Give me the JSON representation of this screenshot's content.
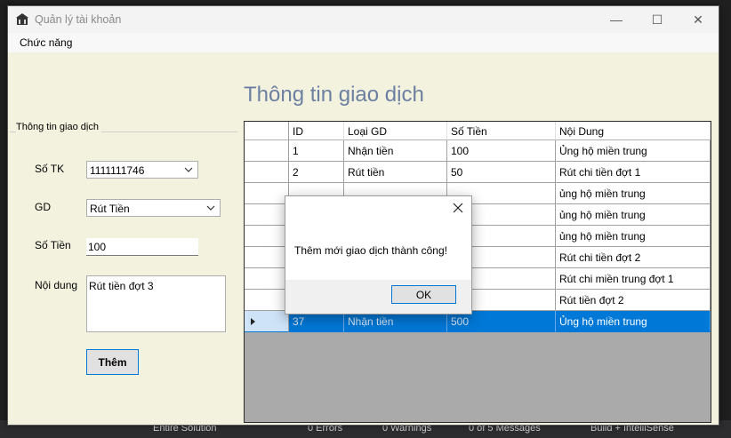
{
  "window": {
    "title": "Quản lý tài khoản",
    "controls": {
      "minimize": "—",
      "maximize": "☐",
      "close": "✕"
    }
  },
  "menu": {
    "items": [
      {
        "label": "Chức năng"
      }
    ]
  },
  "page_title": "Thông tin giao dịch",
  "form": {
    "group_label": "Thông tin giao dịch",
    "account_label": "Số TK",
    "account_value": "1111111746",
    "type_label": "GD",
    "type_value": "Rút Tiền",
    "amount_label": "Số Tiền",
    "amount_value": "100",
    "content_label": "Nội dung",
    "content_value": "Rút tiền đợt 3",
    "add_button": "Thêm"
  },
  "grid": {
    "columns": [
      "ID",
      "Loại GD",
      "Số Tiền",
      "Nội Dung"
    ],
    "rows": [
      {
        "id": "1",
        "type": "Nhận tiền",
        "amount": "100",
        "content": "Ủng hộ miền trung"
      },
      {
        "id": "2",
        "type": "Rút tiền",
        "amount": "50",
        "content": "Rút chi tiền đợt 1"
      },
      {
        "id": "",
        "type": "",
        "amount": "",
        "content": "ủng hộ miền trung"
      },
      {
        "id": "",
        "type": "",
        "amount": "",
        "content": "ủng hộ miền trung"
      },
      {
        "id": "",
        "type": "",
        "amount": "",
        "content": "ủng hộ miền trung"
      },
      {
        "id": "",
        "type": "",
        "amount": "",
        "content": "Rút chi tiền đợt 2"
      },
      {
        "id": "",
        "type": "",
        "amount": "",
        "content": "Rút chi miền trung đợt 1"
      },
      {
        "id": "",
        "type": "",
        "amount": "",
        "content": "Rút tiền đợt 2"
      },
      {
        "id": "37",
        "type": "Nhận tiền",
        "amount": "500",
        "content": "Ủng hộ miền trung",
        "selected": true
      }
    ]
  },
  "dialog": {
    "message": "Thêm mới giao dịch thành công!",
    "ok_label": "OK"
  },
  "status_bar": {
    "items": [
      "Entire Solution",
      "0 Errors",
      "0 Warnings",
      "0 of 5 Messages",
      "Build + IntelliSense"
    ]
  }
}
